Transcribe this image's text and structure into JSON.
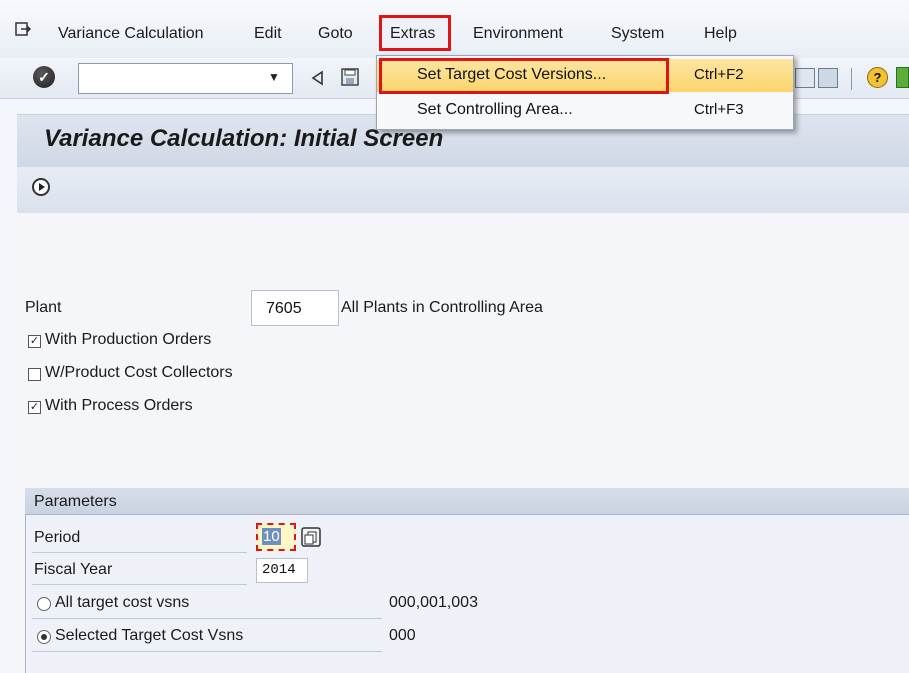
{
  "menubar": {
    "items": [
      {
        "label": "Variance Calculation"
      },
      {
        "label": "Edit"
      },
      {
        "label": "Goto"
      },
      {
        "label": "Extras"
      },
      {
        "label": "Environment"
      },
      {
        "label": "System"
      },
      {
        "label": "Help"
      }
    ]
  },
  "extras_menu": {
    "items": [
      {
        "label": "Set Target Cost Versions...",
        "shortcut": "Ctrl+F2"
      },
      {
        "label": "Set Controlling Area...",
        "shortcut": "Ctrl+F3"
      }
    ]
  },
  "page": {
    "title": "Variance Calculation: Initial Screen"
  },
  "form": {
    "plant_label": "Plant",
    "plant_value": "7605",
    "all_plants_label": "All Plants in Controlling Area",
    "checkboxes": [
      {
        "label": "With Production Orders",
        "checked": true
      },
      {
        "label": "W/Product Cost Collectors",
        "checked": false
      },
      {
        "label": "With Process Orders",
        "checked": true
      }
    ]
  },
  "parameters": {
    "title": "Parameters",
    "period_label": "Period",
    "period_value": "10",
    "fiscal_year_label": "Fiscal Year",
    "fiscal_year_value": "2014",
    "radios": [
      {
        "label": "All target cost vsns",
        "value": "000,001,003",
        "selected": false
      },
      {
        "label": "Selected Target Cost Vsns",
        "value": "000",
        "selected": true
      }
    ]
  },
  "colors": {
    "highlight_red": "#e01414",
    "menu_highlight": "#fbd46c",
    "panel_blue": "#dfe5ef"
  }
}
